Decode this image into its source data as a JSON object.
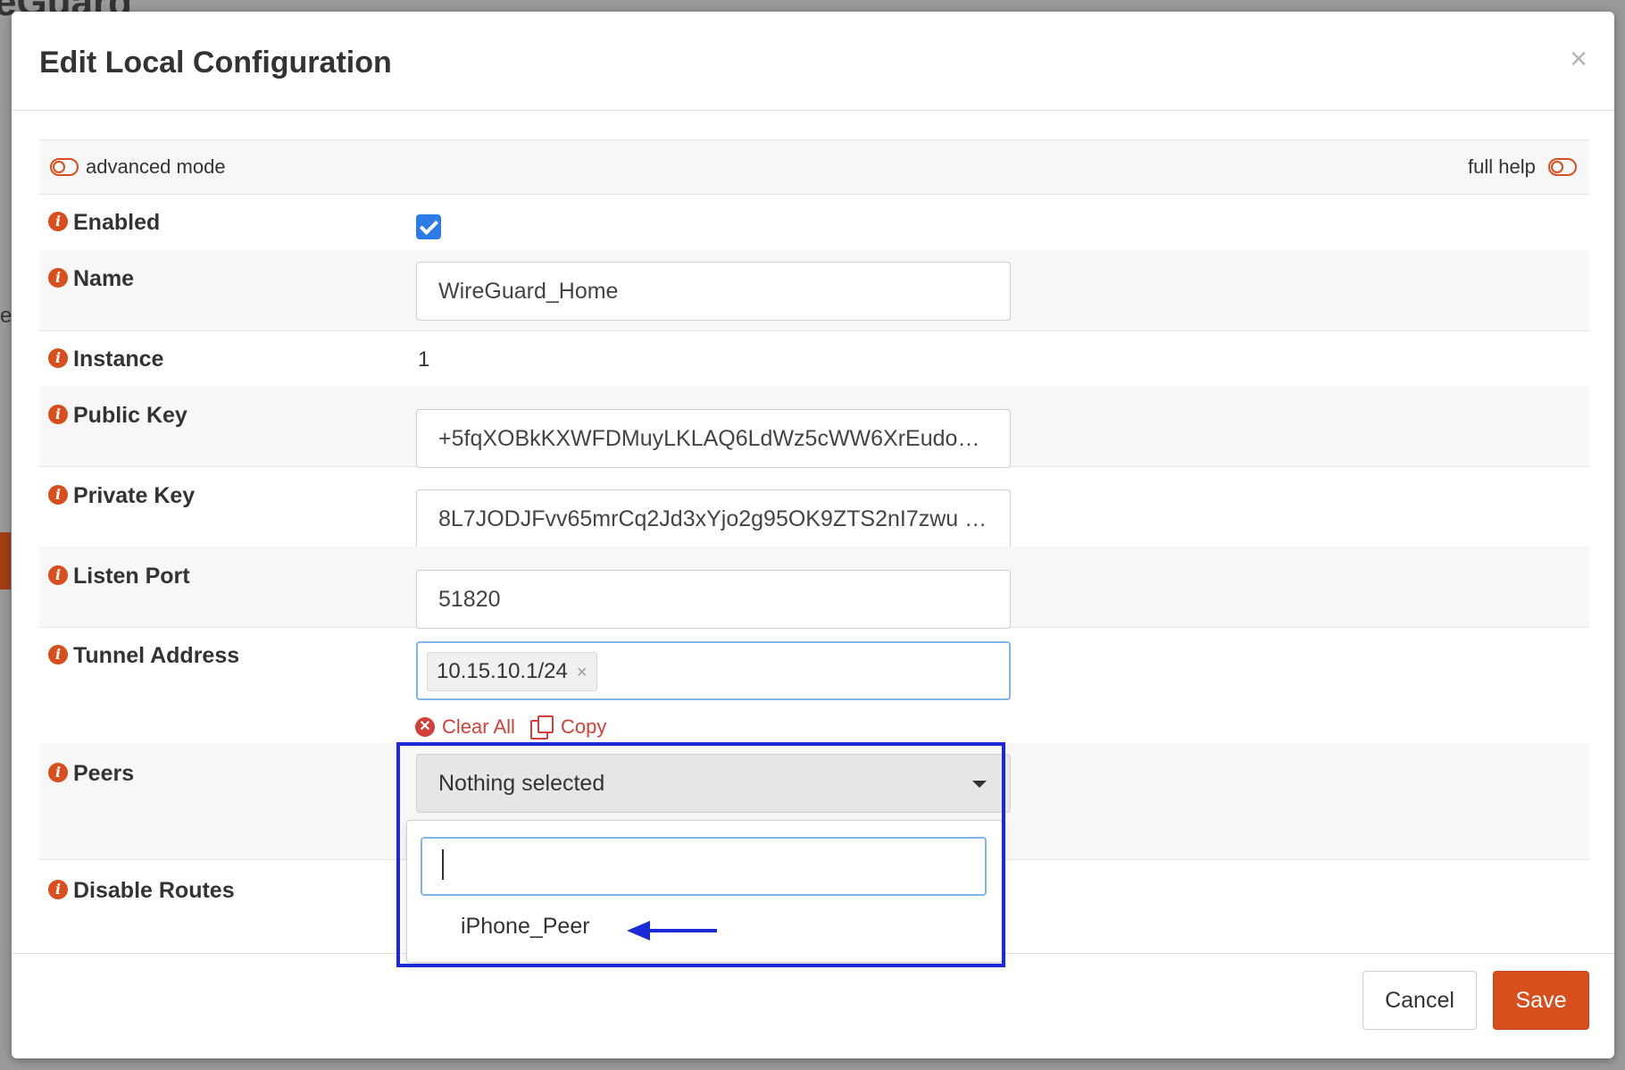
{
  "background": {
    "title_fragment": "eGuard",
    "side_fragment": "e"
  },
  "modal": {
    "title": "Edit Local Configuration",
    "close": "×"
  },
  "toggles": {
    "advanced_mode": "advanced mode",
    "full_help": "full help"
  },
  "fields": {
    "enabled": {
      "label": "Enabled",
      "checked": true
    },
    "name": {
      "label": "Name",
      "value": "WireGuard_Home"
    },
    "instance": {
      "label": "Instance",
      "value": "1"
    },
    "public_key": {
      "label": "Public Key",
      "value": "+5fqXOBkKXWFDMuyLKLAQ6LdWz5cWW6XrEudoZ …"
    },
    "private_key": {
      "label": "Private Key",
      "value": "8L7JODJFvv65mrCq2Jd3xYjo2g95OK9ZTS2nI7zwu …"
    },
    "listen_port": {
      "label": "Listen Port",
      "value": "51820"
    },
    "tunnel_address": {
      "label": "Tunnel Address",
      "tags": [
        "10.15.10.1/24"
      ],
      "tag_remove": "×",
      "clear_all": "Clear All",
      "copy": "Copy"
    },
    "peers": {
      "label": "Peers",
      "selected": "Nothing selected",
      "search_value": "",
      "options": [
        "iPhone_Peer"
      ]
    },
    "disable_routes": {
      "label": "Disable Routes"
    }
  },
  "footer": {
    "cancel": "Cancel",
    "save": "Save"
  },
  "icons": [
    "info-icon",
    "toggle-off-icon",
    "checkbox-checked-icon",
    "remove-tag-icon",
    "clear-all-icon",
    "copy-icon",
    "caret-down-icon",
    "arrow-left-icon",
    "close-icon"
  ],
  "colors": {
    "accent": "#d64f1d",
    "checkbox": "#2d7be6",
    "link_red": "#d43f3a",
    "focus_border": "#82b6ea",
    "annotation": "#1a2ad6"
  }
}
